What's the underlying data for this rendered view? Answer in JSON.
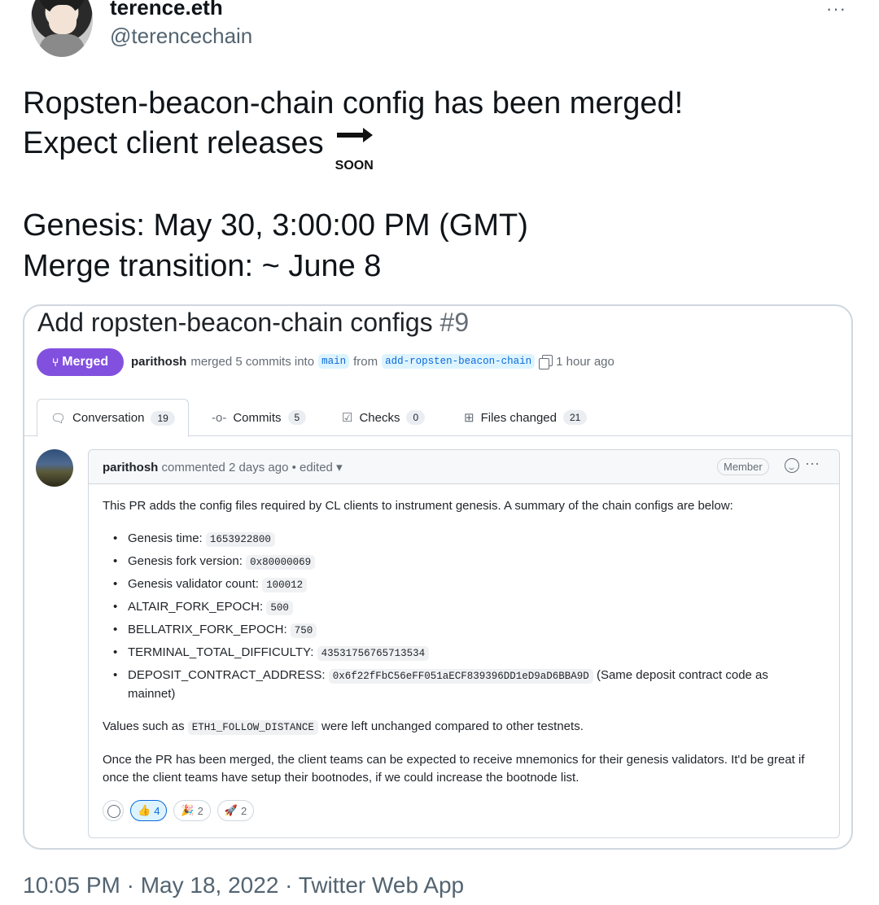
{
  "tweet": {
    "display_name": "terence.eth",
    "handle": "@terencechain",
    "more_label": "···",
    "line1": "Ropsten-beacon-chain config has been merged!",
    "line2": "Expect client releases",
    "soon_label": "SOON",
    "line3": "Genesis: May 30, 3:00:00 PM (GMT)",
    "line4": "Merge transition: ~ June 8",
    "footer": "10:05 PM · May 18, 2022 · Twitter Web App"
  },
  "pr": {
    "title": "Add ropsten-beacon-chain configs",
    "number": "#9",
    "status": "Merged",
    "author": "parithosh",
    "merged_text": "merged 5 commits into",
    "base_branch": "main",
    "from_text": "from",
    "head_branch": "add-ropsten-beacon-chain",
    "time_ago": "1 hour ago",
    "tabs": [
      {
        "label": "Conversation",
        "count": "19"
      },
      {
        "label": "Commits",
        "count": "5"
      },
      {
        "label": "Checks",
        "count": "0"
      },
      {
        "label": "Files changed",
        "count": "21"
      }
    ],
    "comment": {
      "author": "parithosh",
      "meta": "commented 2 days ago • edited",
      "role": "Member",
      "kebab": "···",
      "intro": "This PR adds the config files required by CL clients to instrument genesis. A summary of the chain configs are below:",
      "items": [
        {
          "label": "Genesis time:",
          "value": "1653922800",
          "suffix": ""
        },
        {
          "label": "Genesis fork version:",
          "value": "0x80000069",
          "suffix": ""
        },
        {
          "label": "Genesis validator count:",
          "value": "100012",
          "suffix": ""
        },
        {
          "label": "ALTAIR_FORK_EPOCH:",
          "value": "500",
          "suffix": ""
        },
        {
          "label": "BELLATRIX_FORK_EPOCH:",
          "value": "750",
          "suffix": ""
        },
        {
          "label": "TERMINAL_TOTAL_DIFFICULTY:",
          "value": "43531756765713534",
          "suffix": ""
        },
        {
          "label": "DEPOSIT_CONTRACT_ADDRESS:",
          "value": "0x6f22fFbC56eFF051aECF839396DD1eD9aD6BBA9D",
          "suffix": "(Same deposit contract code as mainnet)"
        }
      ],
      "values_pre": "Values such as",
      "values_code": "ETH1_FOLLOW_DISTANCE",
      "values_post": "were left unchanged compared to other testnets.",
      "closing": "Once the PR has been merged, the client teams can be expected to receive mnemonics for their genesis validators. It'd be great if once the client teams have setup their bootnodes, if we could increase the bootnode list.",
      "reactions": [
        {
          "emoji": "👍",
          "count": "4",
          "icon": "thumbs-up-icon"
        },
        {
          "emoji": "🎉",
          "count": "2",
          "icon": "party-icon"
        },
        {
          "emoji": "🚀",
          "count": "2",
          "icon": "rocket-icon"
        }
      ]
    }
  },
  "colors": {
    "merged": "#8250df",
    "link": "#0969da",
    "muted": "#536471"
  }
}
